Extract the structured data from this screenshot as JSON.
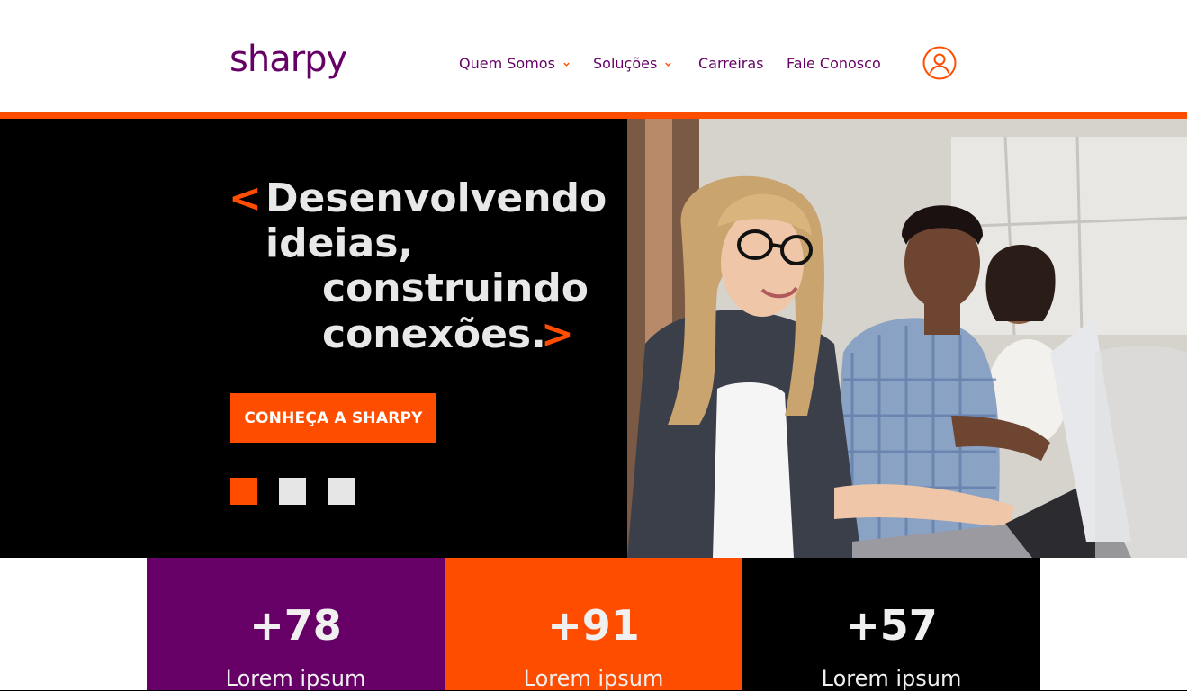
{
  "brand": {
    "logo_text": "sharpy",
    "primary_color": "#660066",
    "accent_color": "#ff4d00"
  },
  "nav": {
    "items": [
      {
        "label": "Quem Somos",
        "dropdown": true
      },
      {
        "label": "Soluções",
        "dropdown": true
      },
      {
        "label": "Carreiras",
        "dropdown": false
      },
      {
        "label": "Fale Conosco",
        "dropdown": false
      }
    ],
    "user_icon": "user-icon"
  },
  "hero": {
    "open_bracket": "<",
    "close_bracket": ">",
    "line1": "Desenvolvendo",
    "line2": "ideias,",
    "line3": "construindo",
    "line4": "conexões.",
    "cta_label": "CONHEÇA A SHARPY",
    "slides_total": 3,
    "slide_active": 1,
    "image_subject": "people-working-at-laptop-photo"
  },
  "stats": [
    {
      "value": "+78",
      "label": "Lorem ipsum",
      "color": "#660066"
    },
    {
      "value": "+91",
      "label": "Lorem ipsum",
      "color": "#ff4d00"
    },
    {
      "value": "+57",
      "label": "Lorem ipsum",
      "color": "#000000"
    }
  ]
}
